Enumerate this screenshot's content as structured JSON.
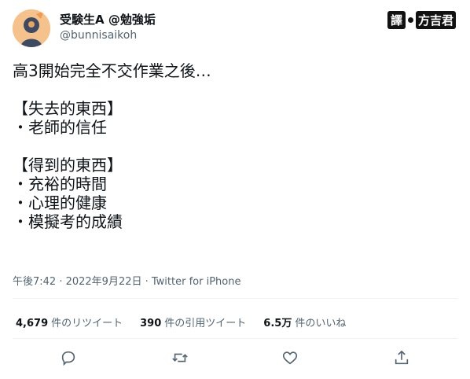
{
  "user": {
    "display_name": "受験生A @勉強垢",
    "handle": "@bunnisaikoh"
  },
  "watermark": {
    "main": "譯",
    "tag": "方吉君"
  },
  "tweet": {
    "text": "高3開始完全不交作業之後…\n\n【失去的東西】\n・老師的信任\n\n【得到的東西】\n・充裕的時間\n・心理的健康\n・模擬考的成績",
    "meta": "午後7:42 · 2022年9月22日 · Twitter for iPhone"
  },
  "stats": {
    "retweets_count": "4,679",
    "retweets_label": "件のリツイート",
    "quotes_count": "390",
    "quotes_label": "件の引用ツイート",
    "likes_count": "6.5万",
    "likes_label": "件のいいね"
  },
  "icons": {
    "reply": "reply-icon",
    "retweet": "retweet-icon",
    "like": "like-icon",
    "share": "share-icon"
  },
  "colors": {
    "text": "#0f1419",
    "secondary": "#536471",
    "divider": "#eff3f4"
  }
}
